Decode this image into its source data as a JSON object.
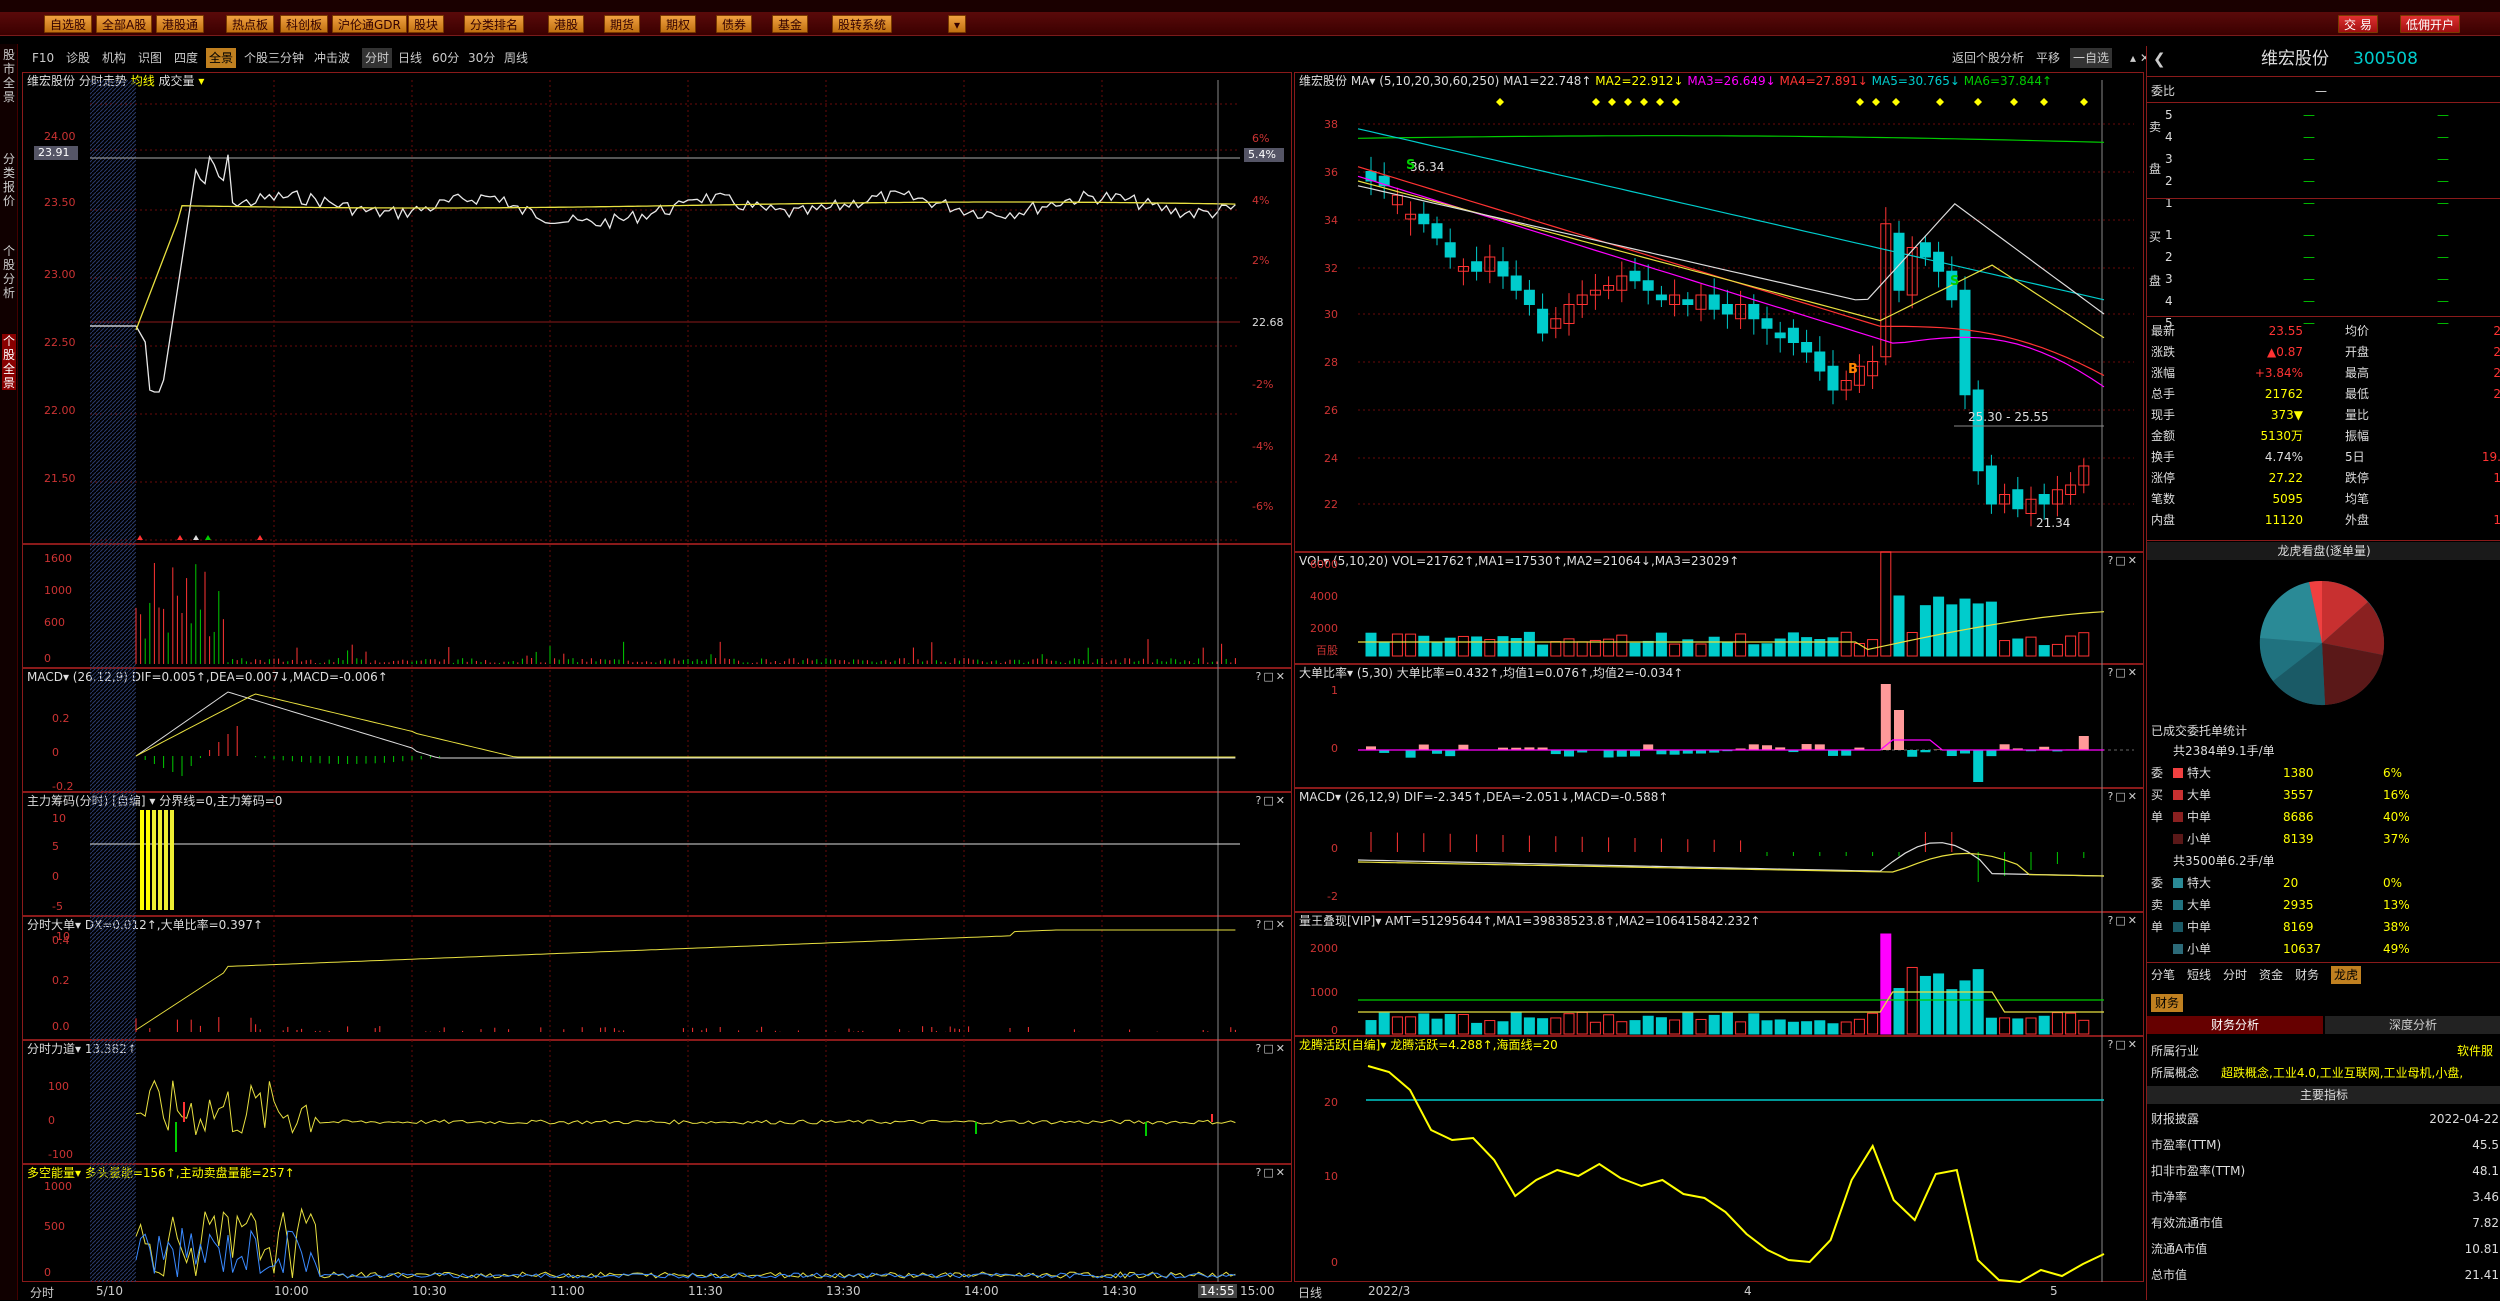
{
  "toolbar": {
    "buttons": [
      "自选股",
      "全部A股",
      "港股通",
      "热点板",
      "科创板",
      "沪伦通GDR",
      "股块",
      "分类排名",
      "港股",
      "期货",
      "期权",
      "债券",
      "基金",
      "股转系统"
    ],
    "trade": "交 易",
    "open_account": "低佣开户"
  },
  "left_strip": [
    "股市全景",
    "分类报价",
    "个股分析",
    "个股全景"
  ],
  "subtabs": [
    "F10",
    "诊股",
    "机构",
    "识图",
    "四度",
    "全景",
    "个股三分钟",
    "冲击波",
    "分时",
    "日线",
    "60分",
    "30分",
    "周线"
  ],
  "subtabs_right": [
    "返回个股分析",
    "平移",
    "一自选"
  ],
  "intraday": {
    "title": "维宏股份",
    "title_items": [
      "分时走势",
      "均线",
      "成交量"
    ],
    "price_axis": [
      "24.00",
      "23.91",
      "23.50",
      "23.00",
      "22.50",
      "22.00",
      "21.50"
    ],
    "pct_axis": [
      "6%",
      "5.4%",
      "4%",
      "2%",
      "22.68",
      "-2%",
      "-4%",
      "-6%"
    ],
    "colors": {
      "price": "#e8e8e8",
      "avg": "#e8e040",
      "grid": "#6a0a0a"
    },
    "x_labels": [
      "分时",
      "5/10",
      "10:00",
      "10:30",
      "11:00",
      "11:30",
      "13:30",
      "14:00",
      "14:30",
      "14:55",
      "15:00"
    ],
    "vol_axis": [
      "1600",
      "1000",
      "600",
      "0"
    ],
    "macd_title": "MACD▾ (26,12,9) DIF=0.005↑,DEA=0.007↓,MACD=-0.006↑",
    "macd_axis": [
      "0.2",
      "0",
      "-0.2"
    ],
    "zl_title": "主力筹码(分时) [自编] ▾ 分界线=0,主力筹码=0",
    "zl_axis": [
      "10",
      "5",
      "0",
      "-5",
      "-10"
    ],
    "dd_title": "分时大单▾ DX=0.012↑,大单比率=0.397↑",
    "dd_axis": [
      "0.4",
      "0.2",
      "0.0"
    ],
    "fl_title": "分时力道▾ 13.382↑",
    "fl_axis": [
      "100",
      "0",
      "-100"
    ],
    "dk_title": "多空能量▾ 多头量能=156↑,主动卖盘量能=257↑",
    "dk_axis": [
      "1000",
      "500",
      "0"
    ]
  },
  "daily": {
    "title": "维宏股份",
    "ma_text": "MA▾ (5,10,20,30,60,250)",
    "ma_values": [
      "MA1=22.748↑",
      "MA2=22.912↓",
      "MA3=26.649↓",
      "MA4=27.891↓",
      "MA5=30.765↓",
      "MA6=37.844↑"
    ],
    "price_axis": [
      "38",
      "36",
      "34",
      "32",
      "30",
      "28",
      "26",
      "24",
      "22"
    ],
    "annotations": {
      "high": "36.34",
      "low": "21.34",
      "range": "25.30 - 25.55",
      "b_mark": "B",
      "s_mark": "S"
    },
    "vol_title": "VOL▾ (5,10,20) VOL=21762↑,MA1=17530↑,MA2=21064↓,MA3=23029↑",
    "vol_axis": [
      "6000",
      "4000",
      "2000",
      "百股"
    ],
    "db_title": "大单比率▾ (5,30) 大单比率=0.432↑,均值1=0.076↑,均值2=-0.034↑",
    "db_axis": [
      "1",
      "0"
    ],
    "macd_title": "MACD▾ (26,12,9) DIF=-2.345↑,DEA=-2.051↓,MACD=-0.588↑",
    "macd_axis": [
      "0",
      "-2"
    ],
    "zl_title": "量王叠现[VIP]▾ AMT=51295644↑,MA1=39838523.8↑,MA2=106415842.232↑",
    "zl_axis": [
      "2000",
      "1000",
      "0"
    ],
    "lt_title": "龙腾活跃[自编]▾ 龙腾活跃=4.288↑,海面线=20",
    "lt_axis": [
      "20",
      "10",
      "0"
    ],
    "x_labels": [
      "日线",
      "2022/3",
      "4",
      "5"
    ]
  },
  "stock": {
    "name": "维宏股份",
    "code": "300508",
    "weibi_label": "委比",
    "weibi_value": "—",
    "sell_label": "卖",
    "pan_label": "盘",
    "buy_label": "买",
    "ob_levels": [
      "5",
      "4",
      "3",
      "2",
      "1",
      "1",
      "2",
      "3",
      "4",
      "5"
    ],
    "quote": [
      [
        "最新",
        "23.55",
        "均价",
        "2"
      ],
      [
        "涨跌",
        "▲0.87",
        "开盘",
        "2"
      ],
      [
        "涨幅",
        "+3.84%",
        "最高",
        "2"
      ],
      [
        "总手",
        "21762",
        "最低",
        "2"
      ],
      [
        "现手",
        "373▼",
        "量比",
        ""
      ],
      [
        "金额",
        "5130万",
        "振幅",
        ""
      ],
      [
        "换手",
        "4.74%",
        "5日",
        "19."
      ],
      [
        "涨停",
        "27.22",
        "跌停",
        "1"
      ],
      [
        "笔数",
        "5095",
        "均笔",
        ""
      ],
      [
        "内盘",
        "11120",
        "外盘",
        "1"
      ]
    ],
    "pie_title": "龙虎看盘(逐单量)",
    "entrust_label": "已成交委托单统计",
    "buy_total": "共2384单9.1手/单",
    "sell_total": "共3500单6.2手/单",
    "buy_side": [
      "委",
      "买",
      "单"
    ],
    "sell_side": [
      "委",
      "卖",
      "单"
    ],
    "buy_rows": [
      [
        "特大",
        "1380",
        "6%"
      ],
      [
        "大单",
        "3557",
        "16%"
      ],
      [
        "中单",
        "8686",
        "40%"
      ],
      [
        "小单",
        "8139",
        "37%"
      ]
    ],
    "sell_rows": [
      [
        "特大",
        "20",
        "0%"
      ],
      [
        "大单",
        "2935",
        "13%"
      ],
      [
        "中单",
        "8169",
        "38%"
      ],
      [
        "小单",
        "10637",
        "49%"
      ]
    ],
    "bottom_tabs": [
      "分笔",
      "短线",
      "分时",
      "资金",
      "财务",
      "龙虎"
    ],
    "fin_tab": "财务",
    "fin_tabs": [
      "财务分析",
      "深度分析"
    ],
    "industry_label": "所属行业",
    "industry": "软件服",
    "concept_label": "所属概念",
    "concept": "超跌概念,工业4.0,工业互联网,工业母机,小盘,",
    "main_index": "主要指标",
    "fin_rows": [
      [
        "财报披露",
        "2022-04-22"
      ],
      [
        "市盈率(TTM)",
        "45.5"
      ],
      [
        "扣非市盈率(TTM)",
        "48.1"
      ],
      [
        "市净率",
        "3.46"
      ],
      [
        "有效流通市值",
        "7.82"
      ],
      [
        "流通A市值",
        "10.81"
      ],
      [
        "总市值",
        "21.41"
      ]
    ]
  }
}
